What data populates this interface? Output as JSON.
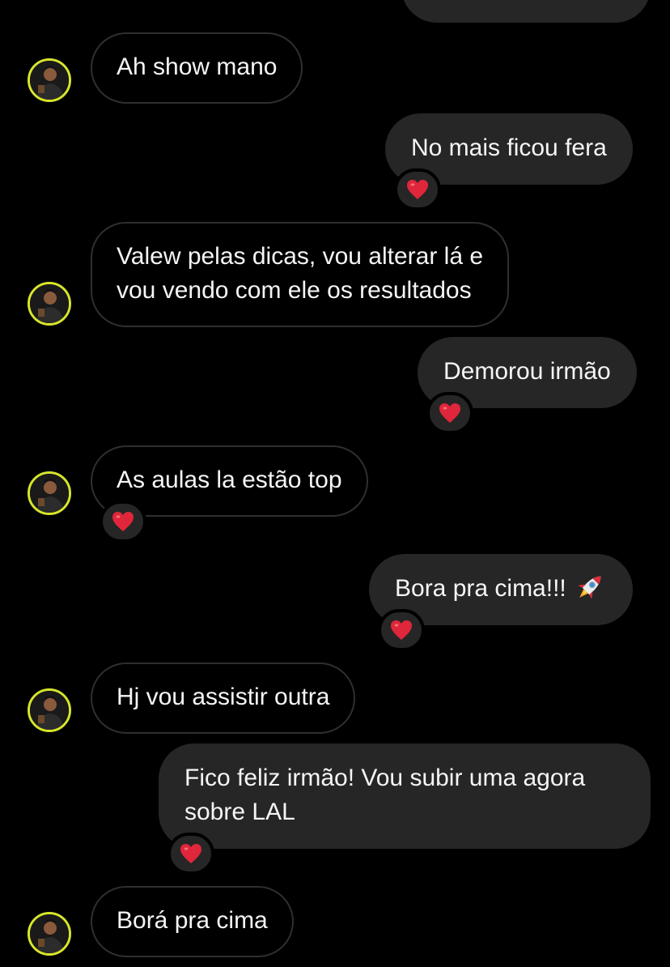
{
  "messages": [
    {
      "id": "m0",
      "direction": "outgoing",
      "text": "",
      "reaction": null
    },
    {
      "id": "m1",
      "direction": "incoming",
      "text": "Ah show mano",
      "reaction": null
    },
    {
      "id": "m2",
      "direction": "outgoing",
      "text": "No mais ficou fera",
      "reaction": "red-heart"
    },
    {
      "id": "m3",
      "direction": "incoming",
      "lines": [
        "Valew pelas dicas, vou alterar lá e",
        "vou vendo com ele os resultados"
      ],
      "reaction": null
    },
    {
      "id": "m4",
      "direction": "outgoing",
      "text": "Demorou irmão",
      "reaction": "red-heart"
    },
    {
      "id": "m5",
      "direction": "incoming",
      "text": "As aulas la estão top",
      "reaction": "red-heart"
    },
    {
      "id": "m6",
      "direction": "outgoing",
      "text": "Bora pra cima!!!",
      "emoji": "rocket",
      "reaction": "red-heart"
    },
    {
      "id": "m7",
      "direction": "incoming",
      "text": "Hj vou assistir outra",
      "reaction": null
    },
    {
      "id": "m8",
      "direction": "outgoing",
      "lines": [
        "Fico feliz irmão! Vou subir uma agora",
        "sobre LAL"
      ],
      "reaction": "red-heart"
    },
    {
      "id": "m9",
      "direction": "incoming",
      "text": "Borá pra cima",
      "reaction": null
    }
  ],
  "colors": {
    "background": "#000000",
    "incoming_border": "#2f2f2f",
    "outgoing_bubble": "#262626",
    "avatar_ring": "#d8e62b",
    "heart": "#e0263a"
  },
  "icons": {
    "avatar": "user-avatar",
    "reaction": "red-heart-icon",
    "emoji": "rocket-icon"
  }
}
